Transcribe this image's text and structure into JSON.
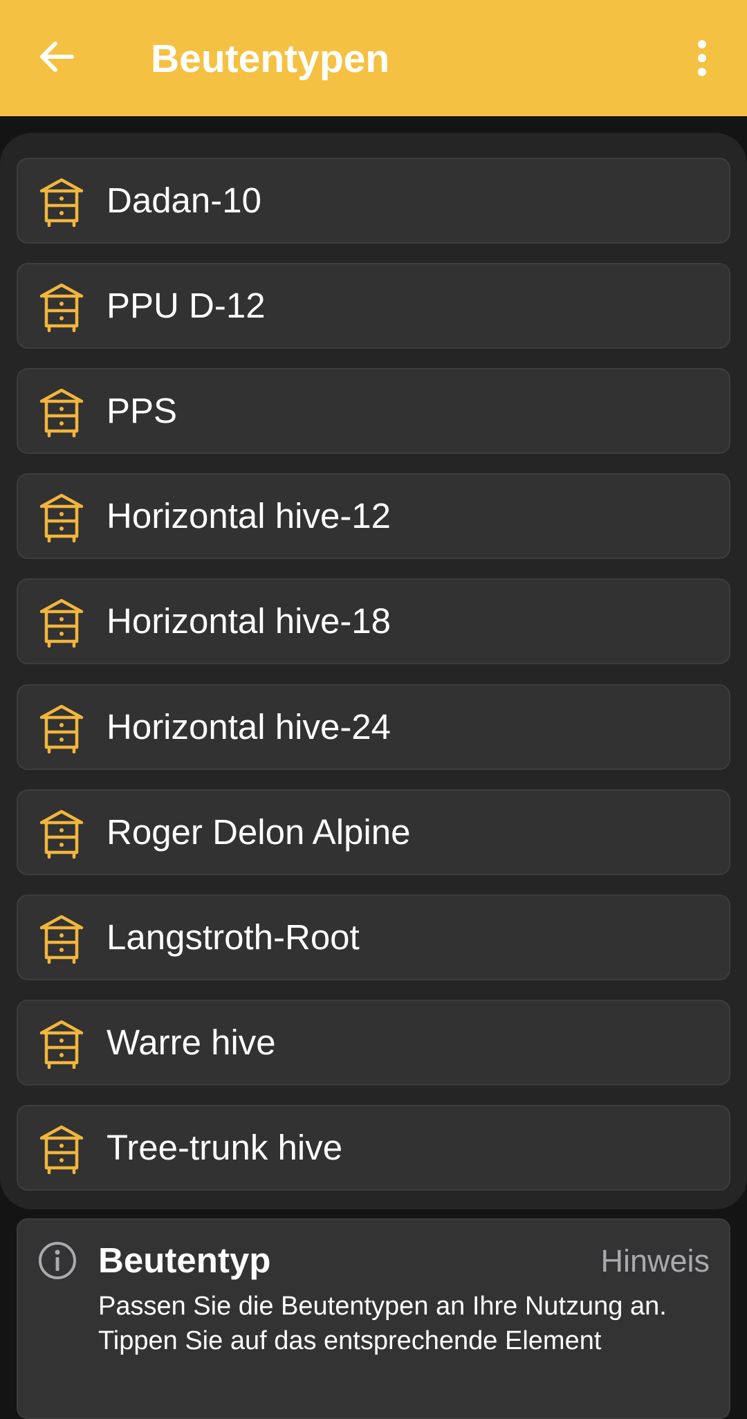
{
  "app_bar": {
    "title": "Beutentypen",
    "back_icon": "arrow-left-icon",
    "menu_icon": "more-vertical-icon",
    "background_color": "#F5C142"
  },
  "hive_types": [
    {
      "label": "Dadan-10",
      "icon": "beehive-icon"
    },
    {
      "label": "PPU D-12",
      "icon": "beehive-icon"
    },
    {
      "label": "PPS",
      "icon": "beehive-icon"
    },
    {
      "label": "Horizontal hive-12",
      "icon": "beehive-icon"
    },
    {
      "label": "Horizontal hive-18",
      "icon": "beehive-icon"
    },
    {
      "label": "Horizontal hive-24",
      "icon": "beehive-icon"
    },
    {
      "label": "Roger Delon Alpine",
      "icon": "beehive-icon"
    },
    {
      "label": "Langstroth-Root",
      "icon": "beehive-icon"
    },
    {
      "label": "Warre hive",
      "icon": "beehive-icon"
    },
    {
      "label": "Tree-trunk hive",
      "icon": "beehive-icon"
    }
  ],
  "info_card": {
    "icon": "info-icon",
    "title": "Beutentyp",
    "hint_label": "Hinweis",
    "text": "Passen Sie die Beutentypen an Ihre Nutzung an. Tippen Sie auf das entsprechende Element"
  },
  "colors": {
    "accent": "#F5C142",
    "icon": "#F2B63C",
    "item_background": "#323232",
    "page_background": "#141414",
    "hint_text": "#a9a9b0"
  }
}
